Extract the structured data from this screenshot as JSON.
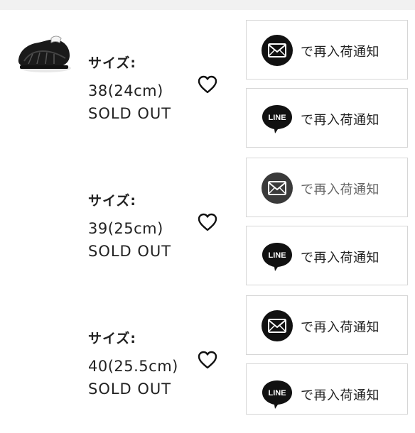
{
  "variants": [
    {
      "size_label": "サイズ:",
      "size_value": "38(24cm)",
      "status": "SOLD OUT",
      "mail_button": "で再入荷通知",
      "line_button": "で再入荷通知"
    },
    {
      "size_label": "サイズ:",
      "size_value": "39(25cm)",
      "status": "SOLD OUT",
      "mail_button": "で再入荷通知",
      "line_button": "で再入荷通知"
    },
    {
      "size_label": "サイズ:",
      "size_value": "40(25.5cm)",
      "status": "SOLD OUT",
      "mail_button": "で再入荷通知",
      "line_button": "で再入荷通知"
    }
  ],
  "line_icon_text": "LINE",
  "icons": {
    "mail": "envelope-icon",
    "line": "line-logo-icon",
    "favorite": "heart-outline-icon"
  }
}
